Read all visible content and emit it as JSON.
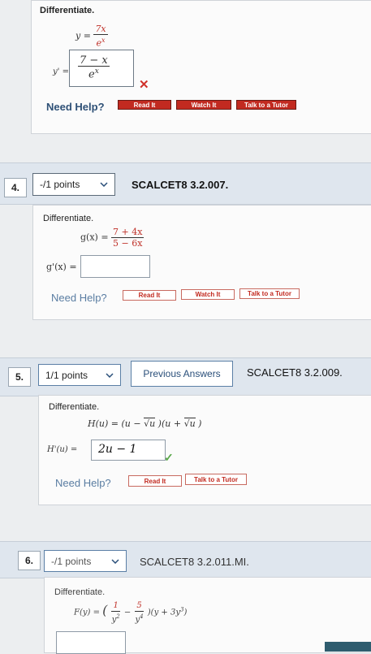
{
  "q3": {
    "label": "Differentiate.",
    "eq_lhs": "y =",
    "eq_num": "7x",
    "eq_den": "e",
    "eq_den_exp": "x",
    "ans_lhs": "y' =",
    "ans_num": "7 − x",
    "ans_den": "e",
    "ans_den_exp": "x",
    "need_help": "Need Help?",
    "read_it": "Read It",
    "watch_it": "Watch It",
    "talk_tutor": "Talk to a Tutor"
  },
  "q4": {
    "number": "4.",
    "points": "-/1 points",
    "code": "SCALCET8 3.2.007.",
    "label": "Differentiate.",
    "eq_lhs": "g(x) =",
    "eq_num": "7 + 4x",
    "eq_den": "5 − 6x",
    "ans_lhs": "g'(x) =",
    "need_help": "Need Help?",
    "read_it": "Read It",
    "watch_it": "Watch It",
    "talk_tutor": "Talk to a Tutor"
  },
  "q5": {
    "number": "5.",
    "points": "1/1 points",
    "previous": "Previous Answers",
    "code": "SCALCET8 3.2.009.",
    "label": "Differentiate.",
    "eq_lhs": "H(u) = (u −",
    "eq_mid": ")(u +",
    "eq_root": "u",
    "eq_end": ")",
    "ans_lhs": "H'(u) =",
    "ans_value": "2u − 1",
    "need_help": "Need Help?",
    "read_it": "Read It",
    "talk_tutor": "Talk to a Tutor"
  },
  "q6": {
    "number": "6.",
    "points": "-/1 points",
    "code": "SCALCET8 3.2.011.MI.",
    "label": "Differentiate.",
    "eq_lhs": "F(y) =",
    "eq_f1_num": "1",
    "eq_f1_den": "y",
    "eq_f1_den_exp": "2",
    "eq_minus": "−",
    "eq_f2_num": "5",
    "eq_f2_den": "y",
    "eq_f2_den_exp": "4",
    "eq_tail": ")(y + 3y",
    "eq_tail_exp": "3",
    "eq_close": ")"
  },
  "colors": {
    "help_red": "#c22a20",
    "accent_blue": "#2f5177",
    "check_green": "#5aa84a"
  }
}
